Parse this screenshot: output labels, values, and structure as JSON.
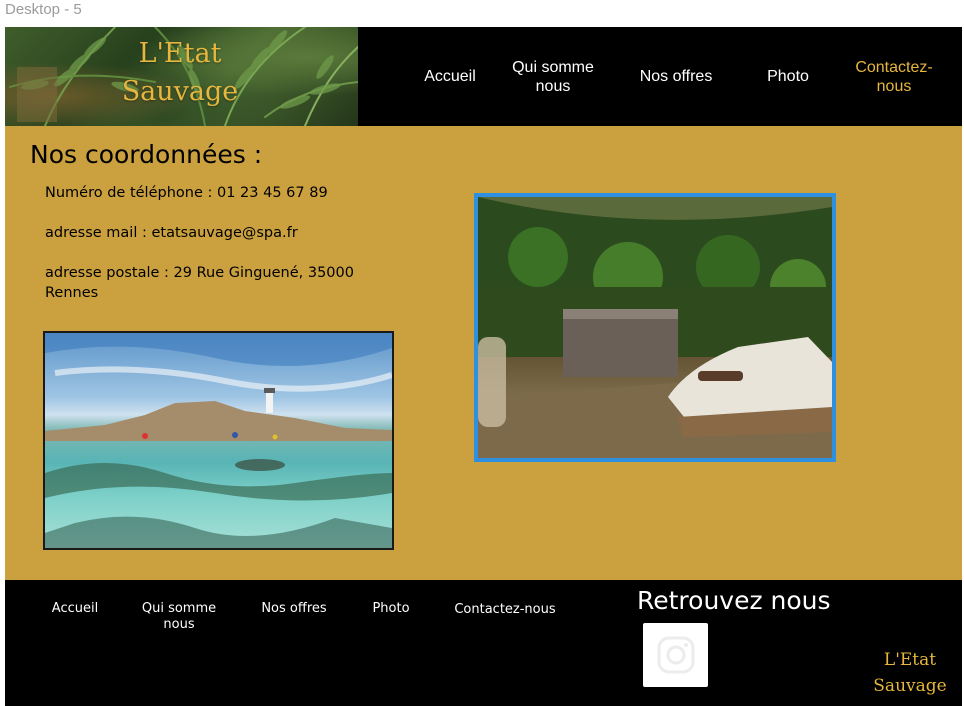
{
  "frame_label": "Desktop - 5",
  "brand": {
    "line1": "L'Etat",
    "line2": "Sauvage"
  },
  "nav": {
    "items": [
      {
        "label": "Accueil"
      },
      {
        "label": "Qui somme nous"
      },
      {
        "label": "Nos offres"
      },
      {
        "label": "Photo"
      },
      {
        "label": "Contactez-nous",
        "active": true
      }
    ]
  },
  "main": {
    "title": "Nos coordonnées :",
    "phone": "Numéro de téléphone : 01 23 45 67 89",
    "email": "adresse mail : etatsauvage@spa.fr",
    "address": "adresse postale : 29 Rue Ginguené, 35000 Rennes"
  },
  "footer": {
    "links": [
      "Accueil",
      "Qui somme nous",
      "Nos offres",
      "Photo",
      "Contactez-nous"
    ],
    "follow_title": "Retrouvez nous",
    "social_icon": "instagram-icon",
    "brand_line1": "L'Etat",
    "brand_line2": "Sauvage"
  },
  "colors": {
    "accent": "#e6b63e",
    "page_background": "#cba140",
    "header_background": "#000000",
    "spa_photo_border": "#2f8fe0"
  }
}
